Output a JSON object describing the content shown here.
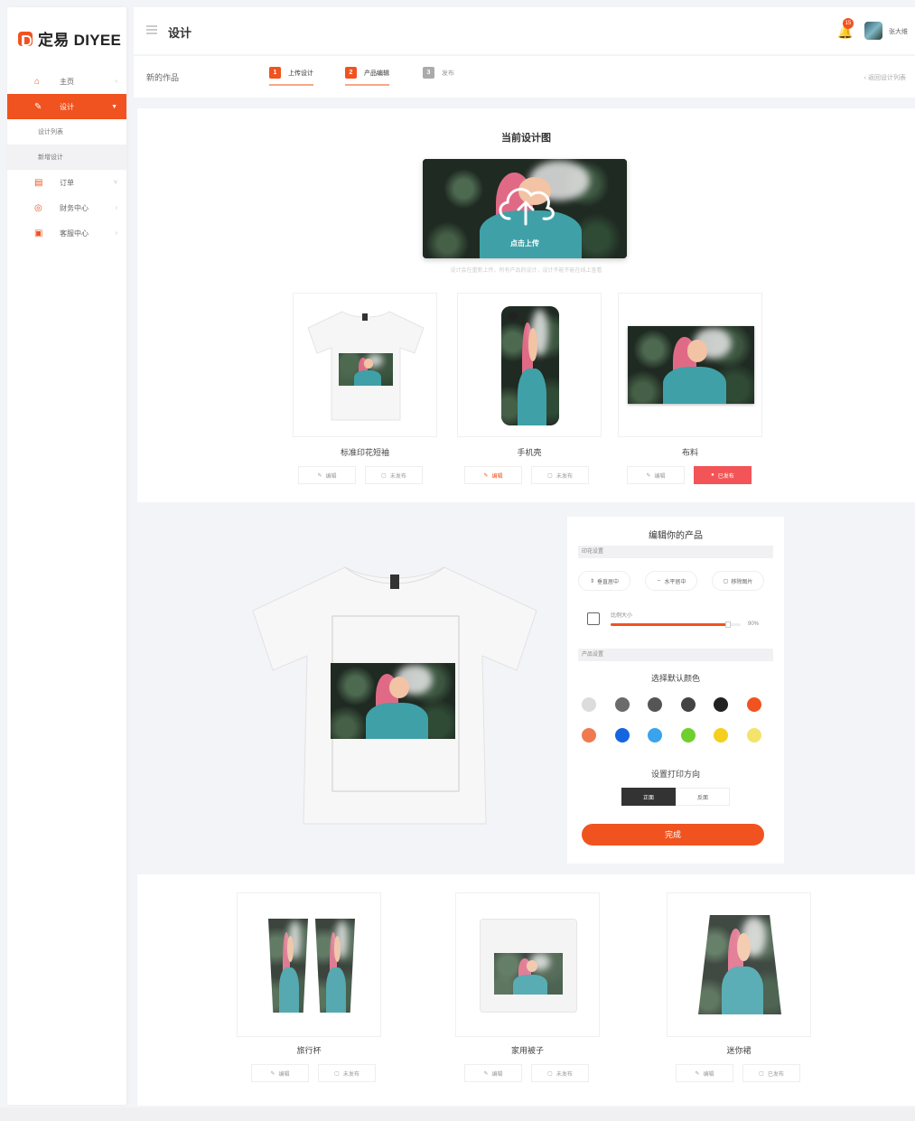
{
  "brand": {
    "name": "定易 DIYEE",
    "accent": "#f0531f"
  },
  "sidebar": {
    "items": [
      {
        "label": "主页",
        "icon": "home-icon",
        "active": false
      },
      {
        "label": "设计",
        "icon": "pen-icon",
        "active": true
      },
      {
        "label": "订单",
        "icon": "document-icon",
        "active": false
      },
      {
        "label": "财务中心",
        "icon": "coin-icon",
        "active": false
      },
      {
        "label": "客服中心",
        "icon": "chat-icon",
        "active": false
      }
    ],
    "subitems": [
      {
        "label": "设计列表"
      },
      {
        "label": "新增设计"
      }
    ]
  },
  "header": {
    "title": "设计",
    "notification_count": "15",
    "username": "张大维"
  },
  "steps": {
    "crumb": "新的作品",
    "items": [
      {
        "num": "1",
        "label": "上传设计"
      },
      {
        "num": "2",
        "label": "产品编辑"
      },
      {
        "num": "3",
        "label": "发布"
      }
    ],
    "back_label": "返回设计列表"
  },
  "upload": {
    "heading": "当前设计图",
    "caption": "点击上传",
    "hint": "设计会在重新上传，所有产品的设计，设计不能不能在线上查看"
  },
  "products_top": [
    {
      "name": "标准印花短袖",
      "edit": "编辑",
      "action": "未发布"
    },
    {
      "name": "手机壳",
      "edit": "编辑",
      "action": "未发布"
    },
    {
      "name": "布料",
      "edit": "编辑",
      "action": "已发布"
    }
  ],
  "editor": {
    "title": "编辑你的产品",
    "print_settings": "印花设置",
    "tools": [
      "垂直居中",
      "水平居中",
      "移除图片"
    ],
    "scale_label": "比例大小",
    "scale_value": "90%",
    "scale_fraction": 0.9,
    "product_settings": "产品设置",
    "color_title": "选择默认颜色",
    "colors": [
      "#dcdcdc",
      "#6b6b6b",
      "#555555",
      "#444444",
      "#222222",
      "#f0531f",
      "#f07a50",
      "#1565e0",
      "#3aa3ee",
      "#6fd02d",
      "#f4d01e",
      "#f3e36b"
    ],
    "orientation_title": "设置打印方向",
    "orientation_options": [
      "正面",
      "反面"
    ],
    "done_label": "完成"
  },
  "products_bottom": [
    {
      "name": "旅行杯",
      "edit": "编辑",
      "action": "未发布"
    },
    {
      "name": "家用被子",
      "edit": "编辑",
      "action": "未发布"
    },
    {
      "name": "迷你裙",
      "edit": "编辑",
      "action": "已发布"
    }
  ]
}
